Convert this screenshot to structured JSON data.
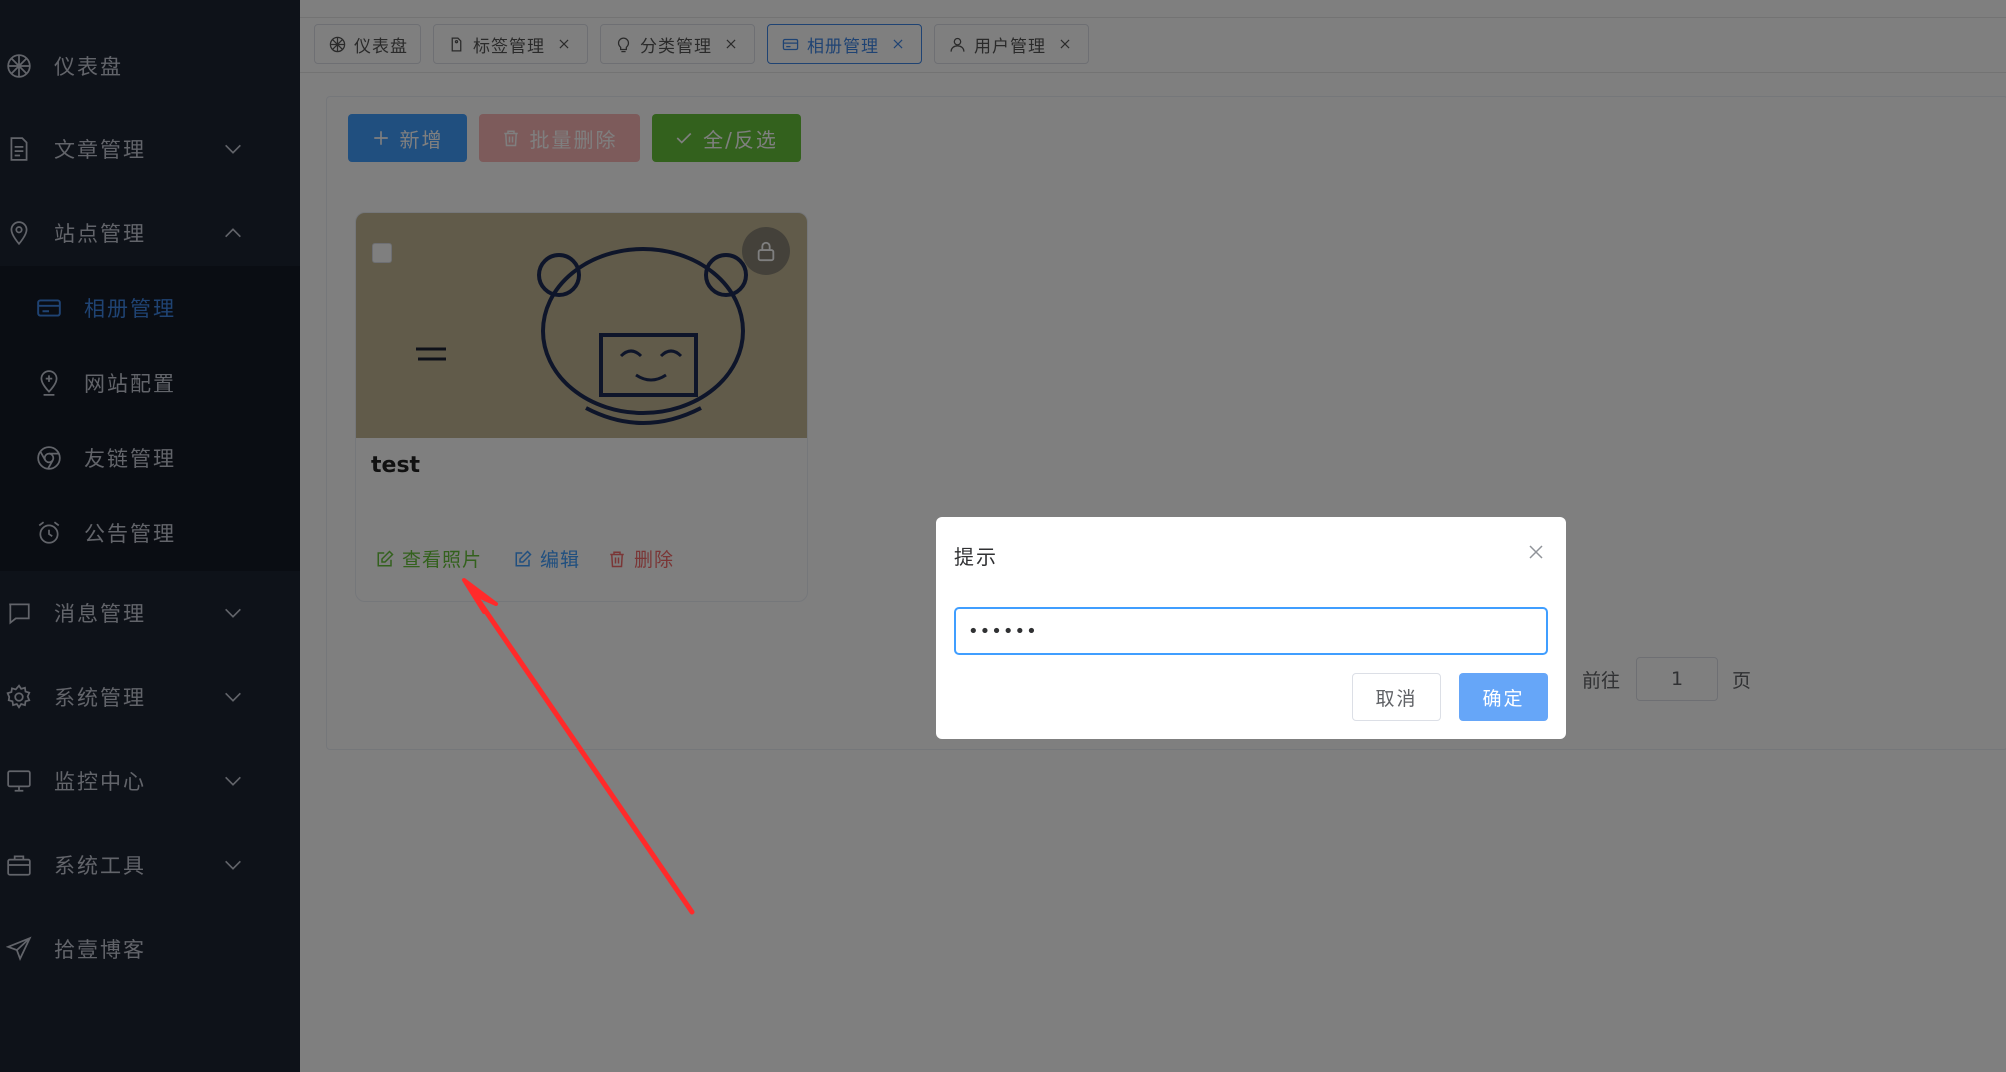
{
  "sidebar": {
    "items": [
      {
        "label": "仪表盘",
        "icon": "dashboard-icon",
        "has_arrow": false
      },
      {
        "label": "文章管理",
        "icon": "document-icon",
        "has_arrow": true,
        "expanded": false
      },
      {
        "label": "站点管理",
        "icon": "location-icon",
        "has_arrow": true,
        "expanded": true
      },
      {
        "label": "消息管理",
        "icon": "message-icon",
        "has_arrow": true,
        "expanded": false
      },
      {
        "label": "系统管理",
        "icon": "gear-icon",
        "has_arrow": true,
        "expanded": false
      },
      {
        "label": "监控中心",
        "icon": "monitor-icon",
        "has_arrow": true,
        "expanded": false
      },
      {
        "label": "系统工具",
        "icon": "toolbox-icon",
        "has_arrow": true,
        "expanded": false
      },
      {
        "label": "拾壹博客",
        "icon": "send-icon",
        "has_arrow": false
      }
    ],
    "sub_items": [
      {
        "label": "相册管理",
        "icon": "card-icon",
        "active": true
      },
      {
        "label": "网站配置",
        "icon": "location-add-icon",
        "active": false
      },
      {
        "label": "友链管理",
        "icon": "chrome-icon",
        "active": false
      },
      {
        "label": "公告管理",
        "icon": "alarm-clock-icon",
        "active": false
      }
    ]
  },
  "tags": [
    {
      "label": "仪表盘",
      "icon": "dashboard-icon",
      "closable": false,
      "active": false
    },
    {
      "label": "标签管理",
      "icon": "tag-icon",
      "closable": true,
      "active": false
    },
    {
      "label": "分类管理",
      "icon": "category-icon",
      "closable": true,
      "active": false
    },
    {
      "label": "相册管理",
      "icon": "card-icon",
      "closable": true,
      "active": true
    },
    {
      "label": "用户管理",
      "icon": "user-icon",
      "closable": true,
      "active": false
    }
  ],
  "toolbar": {
    "add_label": "新增",
    "batch_delete_label": "批量删除",
    "toggle_all_label": "全/反选"
  },
  "album": {
    "title": "test",
    "view_label": "查看照片",
    "edit_label": "编辑",
    "delete_label": "删除",
    "locked": true
  },
  "pagination": {
    "goto_label": "前往",
    "page_value": "1",
    "page_suffix": "页"
  },
  "dialog": {
    "title": "提示",
    "input_value": "••••••",
    "cancel_label": "取消",
    "confirm_label": "确定"
  },
  "colors": {
    "sidebar_bg": "#1d2433",
    "submenu_bg": "#151b27",
    "primary": "#409eff",
    "success": "#67c23a",
    "danger": "#f56c6c",
    "annotation_arrow": "#ff2a2a"
  }
}
